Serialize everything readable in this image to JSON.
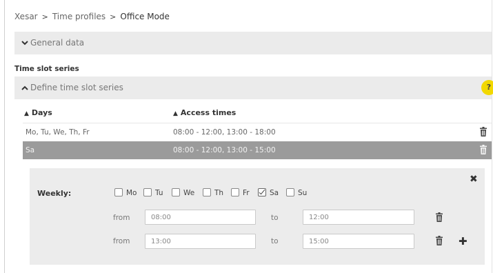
{
  "breadcrumb": {
    "root": "Xesar",
    "parent": "Time profiles",
    "current": "Office Mode"
  },
  "general_panel": {
    "label": "General data",
    "icon": "chevron-down-icon"
  },
  "section": {
    "title": "Time slot series"
  },
  "define_panel": {
    "label": "Define time slot series",
    "icon": "chevron-up-icon"
  },
  "help": {
    "label": "?",
    "color": "#f2d800"
  },
  "table": {
    "headers": {
      "days": "Days",
      "access_times": "Access times"
    },
    "rows": [
      {
        "days": "Mo, Tu, We, Th, Fr",
        "access_times": "08:00 - 12:00, 13:00 - 18:00",
        "selected": false
      },
      {
        "days": "Sa",
        "access_times": "08:00 - 12:00, 13:00 - 15:00",
        "selected": true
      }
    ],
    "selected_row_color": "#9b9b9b"
  },
  "editor": {
    "weekly_label": "Weekly:",
    "days": [
      {
        "label": "Mo",
        "checked": false
      },
      {
        "label": "Tu",
        "checked": false
      },
      {
        "label": "We",
        "checked": false
      },
      {
        "label": "Th",
        "checked": false
      },
      {
        "label": "Fr",
        "checked": false
      },
      {
        "label": "Sa",
        "checked": true
      },
      {
        "label": "Su",
        "checked": false
      }
    ],
    "slots": [
      {
        "from_label": "from",
        "from": "08:00",
        "to_label": "to",
        "to": "12:00"
      },
      {
        "from_label": "from",
        "from": "13:00",
        "to_label": "to",
        "to": "15:00"
      }
    ],
    "close_icon": "close-icon",
    "add_icon": "plus-icon"
  }
}
